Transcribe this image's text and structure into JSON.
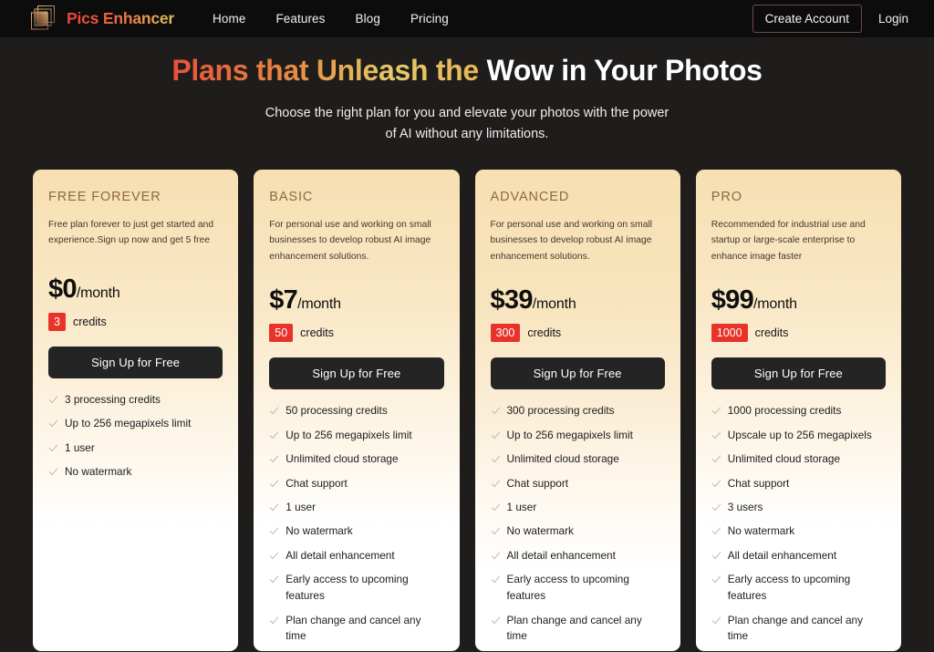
{
  "navbar": {
    "logo_icon": "stacked-squares-logo-icon",
    "brand": "Pics Enhancer",
    "links": [
      {
        "label": "Home"
      },
      {
        "label": "Features"
      },
      {
        "label": "Blog"
      },
      {
        "label": "Pricing"
      }
    ],
    "create_account": "Create Account",
    "login": "Login",
    "accent_border": "#6b4b48",
    "background": "#0d0c0c"
  },
  "hero": {
    "title_gradient_part": "Plans that Unleash the",
    "title_plain_part": " Wow in Your Photos",
    "subtitle_line1": "Choose the right plan for you and elevate your photos with the power",
    "subtitle_line2": "of AI without any limitations.",
    "gradient_start": "#e8503a",
    "gradient_end": "#e6ca67"
  },
  "theme": {
    "page_background": "#1e1d1c",
    "card_gradient_top": "#f7dfb2",
    "card_gradient_bottom": "#ffffff",
    "badge_color": "#e8332a",
    "button_color": "#242424",
    "plan_name_color": "#8d6a3f"
  },
  "plans": [
    {
      "name": "FREE FOREVER",
      "description": "Free plan forever to just get started and experience.Sign up now and get 5 free",
      "price": "$0",
      "period": "/month",
      "credits": "3",
      "credits_label": "credits",
      "cta": "Sign Up for Free",
      "features": [
        "3 processing credits",
        "Up to 256 megapixels limit",
        "1 user",
        "No watermark"
      ]
    },
    {
      "name": "BASIC",
      "description": "For personal use and working on small businesses to develop robust AI image enhancement solutions.",
      "price": "$7",
      "period": "/month",
      "credits": "50",
      "credits_label": "credits",
      "cta": "Sign Up for Free",
      "features": [
        "50 processing credits",
        "Up to 256 megapixels limit",
        "Unlimited cloud storage",
        "Chat support",
        "1 user",
        "No watermark",
        "All detail enhancement",
        "Early access to upcoming features",
        "Plan change and cancel any time"
      ]
    },
    {
      "name": "ADVANCED",
      "description": "For personal use and working on small businesses to develop robust AI image enhancement solutions.",
      "price": "$39",
      "period": "/month",
      "credits": "300",
      "credits_label": "credits",
      "cta": "Sign Up for Free",
      "features": [
        "300 processing credits",
        "Up to 256 megapixels limit",
        "Unlimited cloud storage",
        "Chat support",
        "1 user",
        "No watermark",
        "All detail enhancement",
        "Early access to upcoming features",
        "Plan change and cancel any time"
      ]
    },
    {
      "name": "PRO",
      "description": "Recommended for industrial use and startup or large-scale enterprise to enhance image faster",
      "price": "$99",
      "period": "/month",
      "credits": "1000",
      "credits_label": "credits",
      "cta": "Sign Up for Free",
      "features": [
        "1000 processing credits",
        "Upscale up to 256 megapixels",
        "Unlimited cloud storage",
        "Chat support",
        "3 users",
        "No watermark",
        "All detail enhancement",
        "Early access to upcoming features",
        "Plan change and cancel any time"
      ]
    }
  ]
}
